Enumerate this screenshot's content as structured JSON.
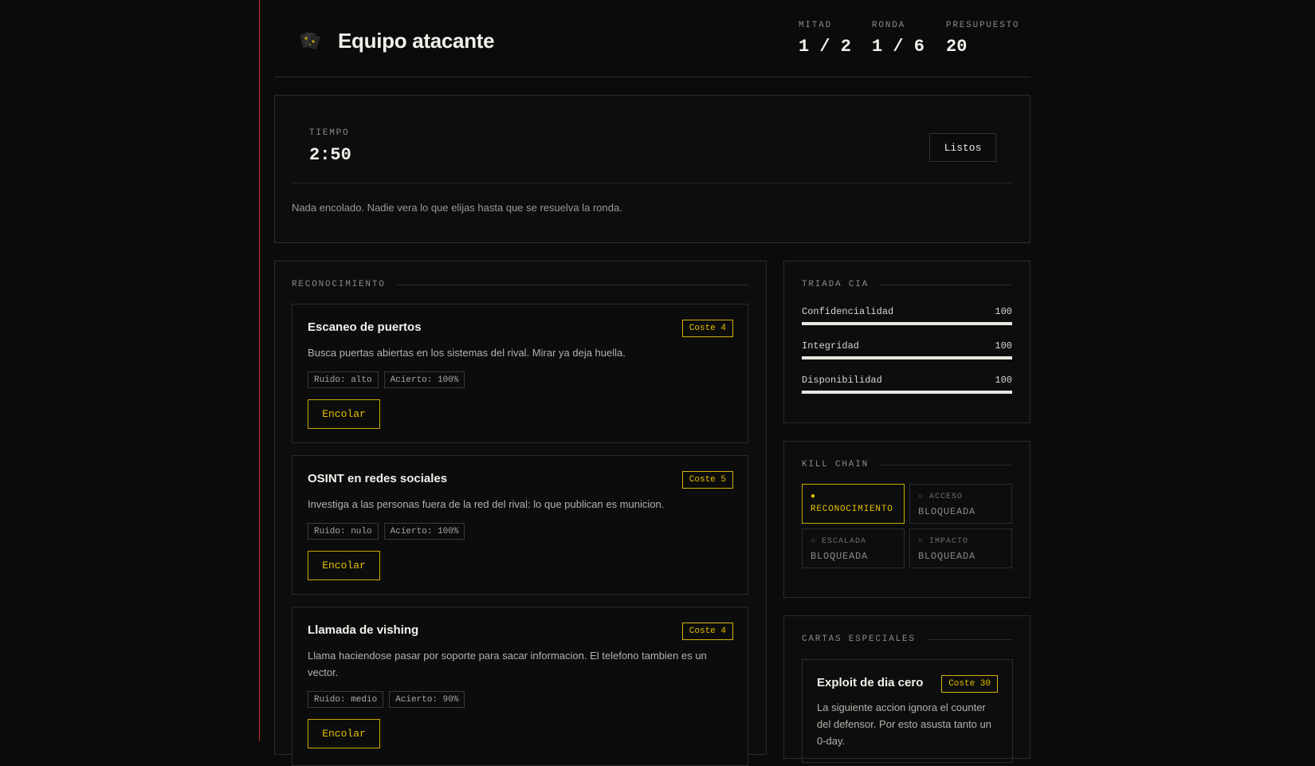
{
  "header": {
    "team_title": "Equipo atacante",
    "stats": [
      {
        "label": "MITAD",
        "value": "1 / 2"
      },
      {
        "label": "RONDA",
        "value": "1 / 6"
      },
      {
        "label": "PRESUPUESTO",
        "value": "20"
      }
    ]
  },
  "timer": {
    "label": "TIEMPO",
    "value": "2:50",
    "ready_label": "Listos",
    "queue_note": "Nada encolado. Nadie vera lo que elijas hasta que se resuelva la ronda."
  },
  "recon": {
    "heading": "RECONOCIMIENTO",
    "cards": [
      {
        "title": "Escaneo de puertos",
        "cost": "Coste 4",
        "desc": "Busca puertas abiertas en los sistemas del rival. Mirar ya deja huella.",
        "noise": "Ruido: alto",
        "hit": "Acierto: 100%",
        "button": "Encolar"
      },
      {
        "title": "OSINT en redes sociales",
        "cost": "Coste 5",
        "desc": "Investiga a las personas fuera de la red del rival: lo que publican es municion.",
        "noise": "Ruido: nulo",
        "hit": "Acierto: 100%",
        "button": "Encolar"
      },
      {
        "title": "Llamada de vishing",
        "cost": "Coste 4",
        "desc": "Llama haciendose pasar por soporte para sacar informacion. El telefono tambien es un vector.",
        "noise": "Ruido: medio",
        "hit": "Acierto: 90%",
        "button": "Encolar"
      }
    ]
  },
  "cia": {
    "heading": "TRIADA CIA",
    "rows": [
      {
        "name": "Confidencialidad",
        "value": "100",
        "level": 1.0
      },
      {
        "name": "Integridad",
        "value": "100",
        "level": 1.0
      },
      {
        "name": "Disponibilidad",
        "value": "100",
        "level": 1.0
      }
    ]
  },
  "kill_chain": {
    "heading": "KILL CHAIN",
    "stages": [
      {
        "top": "●",
        "bottom": "RECONOCIMIENTO",
        "active": true
      },
      {
        "top": "○ ACCESO",
        "bottom": "BLOQUEADA",
        "active": false
      },
      {
        "top": "○ ESCALADA",
        "bottom": "BLOQUEADA",
        "active": false
      },
      {
        "top": "○ IMPACTO",
        "bottom": "BLOQUEADA",
        "active": false
      }
    ]
  },
  "special": {
    "heading": "CARTAS ESPECIALES",
    "card": {
      "title": "Exploit de dia cero",
      "cost": "Coste 30",
      "desc": "La siguiente accion ignora el counter del defensor. Por esto asusta tanto un 0-day."
    }
  },
  "colors": {
    "background": "#0b0b0b",
    "accent": "#e5c100",
    "border": "#2b2b2b",
    "sidebar_line": "#c0392b"
  }
}
